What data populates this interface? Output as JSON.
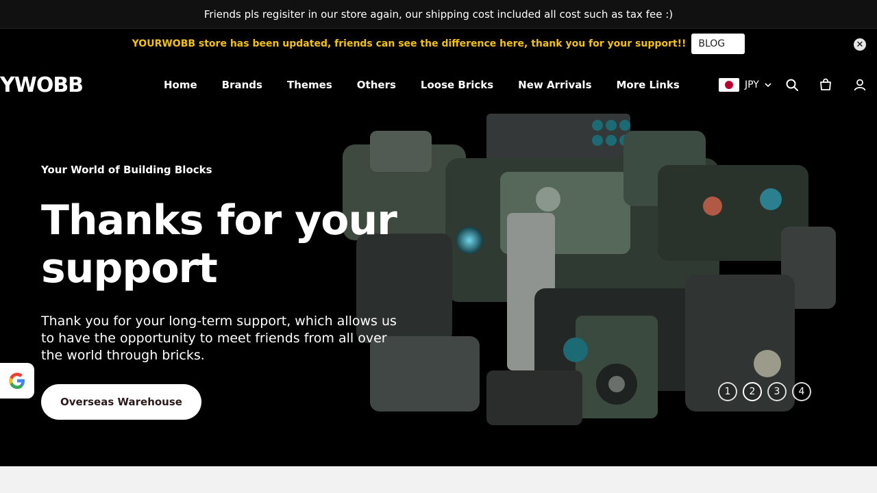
{
  "top_bar": {
    "text": "Friends pls regisiter in our store again, our shipping cost included all cost such as tax fee :)"
  },
  "announcement": {
    "text": "YOURWOBB store has been updated, friends can see the difference here, thank you for your support!!",
    "blog_label": "BLOG",
    "accent_color": "#f3c20c"
  },
  "header": {
    "logo": "YWOBB",
    "nav": [
      "Home",
      "Brands",
      "Themes",
      "Others",
      "Loose Bricks",
      "New Arrivals",
      "More Links"
    ],
    "currency": "JPY",
    "icons": [
      "search-icon",
      "cart-icon",
      "account-icon"
    ]
  },
  "hero": {
    "eyebrow": "Your World of Building Blocks",
    "headline": "Thanks for your support",
    "description": "Thank you for your long-term support, which allows us to have the opportunity to meet friends from all over the world through bricks.",
    "cta": "Overseas Warehouse",
    "slides": [
      "1",
      "2",
      "3",
      "4"
    ],
    "active_slide": 2
  }
}
